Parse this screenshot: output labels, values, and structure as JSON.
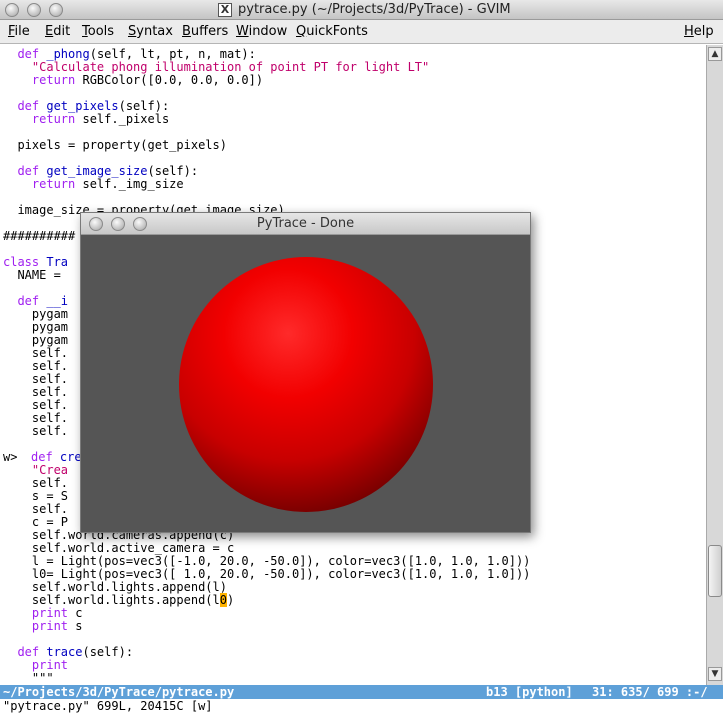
{
  "window": {
    "title": "pytrace.py (~/Projects/3d/PyTrace) - GVIM",
    "title_icon": "X"
  },
  "menubar": {
    "items": [
      {
        "mnemonic": "F",
        "rest": "ile"
      },
      {
        "mnemonic": "E",
        "rest": "dit"
      },
      {
        "mnemonic": "T",
        "rest": "ools"
      },
      {
        "mnemonic": "S",
        "rest": "yntax"
      },
      {
        "mnemonic": "B",
        "rest": "uffers"
      },
      {
        "mnemonic": "W",
        "rest": "indow"
      },
      {
        "mnemonic": "Q",
        "rest": "uickFonts"
      },
      {
        "mnemonic": "H",
        "rest": "elp"
      }
    ]
  },
  "editor": {
    "sign_marker": "w>",
    "lines": [
      [
        [
          "kw",
          "  def "
        ],
        [
          "fn",
          "_phong"
        ],
        [
          "nm",
          "(self, lt, pt, n, mat):"
        ]
      ],
      [
        [
          "str",
          "    \"Calculate phong illumination of point PT for light LT\""
        ]
      ],
      [
        [
          "kw",
          "    return "
        ],
        [
          "nm",
          "RGBColor([0.0, 0.0, 0.0])"
        ]
      ],
      [
        [
          "nm",
          ""
        ]
      ],
      [
        [
          "kw",
          "  def "
        ],
        [
          "fn",
          "get_pixels"
        ],
        [
          "nm",
          "(self):"
        ]
      ],
      [
        [
          "kw",
          "    return "
        ],
        [
          "nm",
          "self._pixels"
        ]
      ],
      [
        [
          "nm",
          ""
        ]
      ],
      [
        [
          "nm",
          "  pixels = property(get_pixels)"
        ]
      ],
      [
        [
          "nm",
          ""
        ]
      ],
      [
        [
          "kw",
          "  def "
        ],
        [
          "fn",
          "get_image_size"
        ],
        [
          "nm",
          "(self):"
        ]
      ],
      [
        [
          "kw",
          "    return "
        ],
        [
          "nm",
          "self._img_size"
        ]
      ],
      [
        [
          "nm",
          ""
        ]
      ],
      [
        [
          "nm",
          "  image_size = property(get_image_size)"
        ]
      ],
      [
        [
          "nm",
          ""
        ]
      ],
      [
        [
          "nm",
          "##########"
        ]
      ],
      [
        [
          "nm",
          ""
        ]
      ],
      [
        [
          "kw",
          "class "
        ],
        [
          "fn",
          "Tra"
        ]
      ],
      [
        [
          "nm",
          "  NAME = "
        ]
      ],
      [
        [
          "nm",
          ""
        ]
      ],
      [
        [
          "kw",
          "  def "
        ],
        [
          "fn",
          "__i"
        ]
      ],
      [
        [
          "nm",
          "    pygam"
        ]
      ],
      [
        [
          "nm",
          "    pygam"
        ]
      ],
      [
        [
          "nm",
          "    pygam"
        ]
      ],
      [
        [
          "nm",
          "    self."
        ]
      ],
      [
        [
          "nm",
          "    self."
        ]
      ],
      [
        [
          "nm",
          "    self."
        ]
      ],
      [
        [
          "nm",
          "    self."
        ]
      ],
      [
        [
          "nm",
          "    self."
        ]
      ],
      [
        [
          "nm",
          "    self."
        ]
      ],
      [
        [
          "nm",
          "    self."
        ]
      ],
      [
        [
          "nm",
          ""
        ]
      ],
      [
        [
          "kw",
          "  def "
        ],
        [
          "fn",
          "cre"
        ]
      ],
      [
        [
          "str",
          "    \"Crea"
        ]
      ],
      [
        [
          "nm",
          "    self."
        ]
      ],
      [
        [
          "nm",
          "    s = S"
        ]
      ],
      [
        [
          "nm",
          "    self."
        ]
      ],
      [
        [
          "nm",
          "    c = P"
        ]
      ],
      [
        [
          "nm",
          "    self.world.cameras.append(c)"
        ]
      ],
      [
        [
          "nm",
          "    self.world.active_camera = c"
        ]
      ],
      [
        [
          "nm",
          "    l = Light(pos=vec3([-1.0, 20.0, -50.0]), color=vec3([1.0, 1.0, 1.0]))"
        ]
      ],
      [
        [
          "nm",
          "    l0= Light(pos=vec3([ 1.0, 20.0, -50.0]), color=vec3([1.0, 1.0, 1.0]))"
        ]
      ],
      [
        [
          "nm",
          "    self.world.lights.append(l)"
        ]
      ],
      [
        [
          "nm",
          "    self.world.lights.append(l"
        ],
        [
          "hl",
          "0"
        ],
        [
          "nm",
          ")"
        ]
      ],
      [
        [
          "kw",
          "    print "
        ],
        [
          "nm",
          "c"
        ]
      ],
      [
        [
          "kw",
          "    print "
        ],
        [
          "nm",
          "s"
        ]
      ],
      [
        [
          "nm",
          ""
        ]
      ],
      [
        [
          "kw",
          "  def "
        ],
        [
          "fn",
          "trace"
        ],
        [
          "nm",
          "(self):"
        ]
      ],
      [
        [
          "kw",
          "    print"
        ]
      ],
      [
        [
          "nm",
          "    \"\"\""
        ]
      ]
    ]
  },
  "statusline": {
    "path": "~/Projects/3d/PyTrace/pytrace.py",
    "buffer": "b13 [python]",
    "position": "31: 635/ 699 :-/"
  },
  "cmdline": "\"pytrace.py\" 699L, 20415C [w]",
  "pytrace": {
    "title": "PyTrace - Done",
    "background_color": "#555555",
    "sphere_color": "#ff0000"
  }
}
